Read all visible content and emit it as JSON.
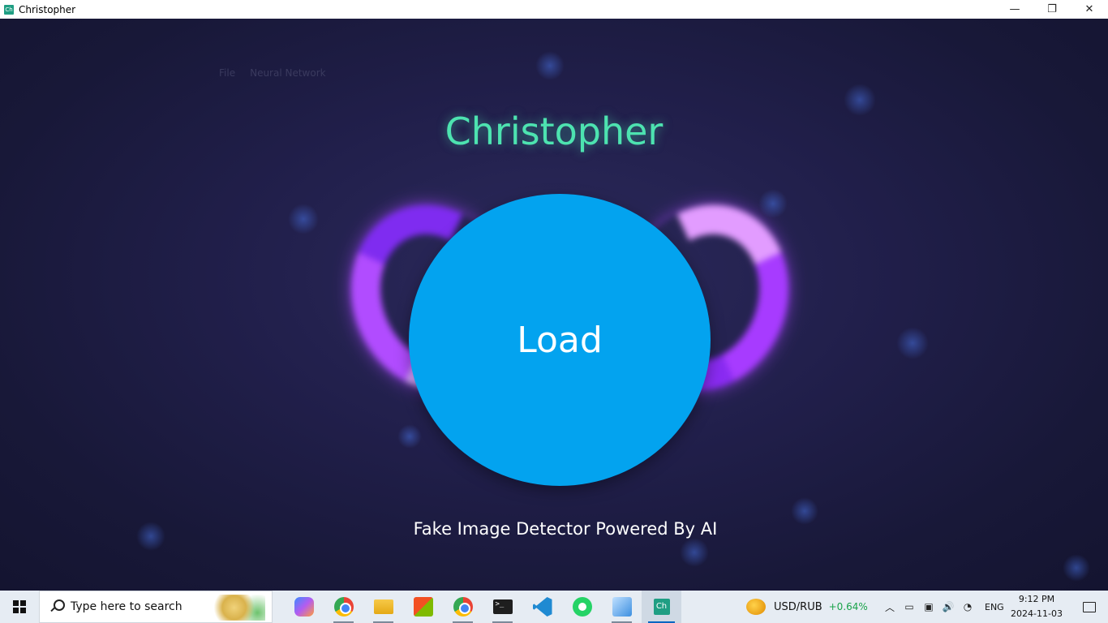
{
  "window": {
    "title": "Christopher",
    "icon_text": "Ch",
    "controls": {
      "minimize": "—",
      "restore": "❐",
      "close": "✕"
    }
  },
  "menu": {
    "items": [
      "File",
      "Neural Network"
    ]
  },
  "app": {
    "title": "Christopher",
    "load_label": "Load",
    "subtitle": "Fake Image Detector Powered By AI"
  },
  "colors": {
    "title": "#4de3b0",
    "load_button": "#03a3ef",
    "rings": "#a83cff",
    "change_positive": "#1aa34a"
  },
  "taskbar": {
    "search_placeholder": "Type here to search",
    "apps": [
      {
        "name": "copilot",
        "icon": "copilot-icon"
      },
      {
        "name": "chrome",
        "icon": "chrome-icon"
      },
      {
        "name": "file-explorer",
        "icon": "folder-icon"
      },
      {
        "name": "microsoft-store",
        "icon": "store-icon"
      },
      {
        "name": "chrome-profile",
        "icon": "chrome-icon"
      },
      {
        "name": "terminal",
        "icon": "terminal-icon"
      },
      {
        "name": "vscode",
        "icon": "vscode-icon"
      },
      {
        "name": "whatsapp",
        "icon": "whatsapp-icon"
      },
      {
        "name": "virtualbox",
        "icon": "box-icon"
      },
      {
        "name": "christopher",
        "icon": "christopher-app-icon",
        "icon_text": "Ch"
      }
    ],
    "ticker": {
      "pair": "USD/RUB",
      "change": "+0.64%"
    },
    "tray": {
      "language": "ENG"
    },
    "clock": {
      "time": "9:12 PM",
      "date": "2024-11-03"
    }
  }
}
